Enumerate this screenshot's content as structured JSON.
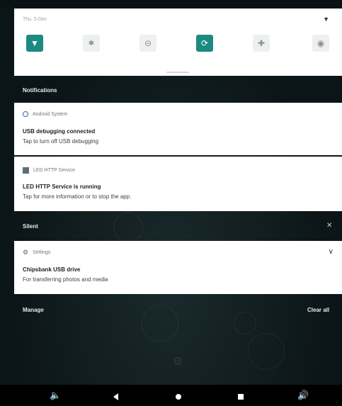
{
  "quick_settings": {
    "date": "Thu, 5 Dec",
    "tiles": [
      {
        "name": "wifi",
        "icon": "wifi-icon",
        "state": "on"
      },
      {
        "name": "bluetooth",
        "icon": "bluetooth-icon",
        "state": "off"
      },
      {
        "name": "do-not-disturb",
        "icon": "dnd-icon",
        "state": "off"
      },
      {
        "name": "auto-rotate",
        "icon": "rotate-icon",
        "state": "on"
      },
      {
        "name": "airplane-mode",
        "icon": "airplane-icon",
        "state": "off"
      },
      {
        "name": "location",
        "icon": "location-icon",
        "state": "off"
      }
    ],
    "accent_color": "#1d8a82"
  },
  "sections": {
    "notifications_label": "Notifications",
    "silent_label": "Silent",
    "manage_label": "Manage",
    "clear_all_label": "Clear all"
  },
  "notifications": [
    {
      "app": "Android System",
      "title": "USB debugging connected",
      "text": "Tap to turn off USB debugging"
    },
    {
      "app": "LED HTTP Service",
      "title": "LED HTTP Service is running",
      "text": "Tap for more information or to stop the app."
    }
  ],
  "silent_notifications": [
    {
      "app": "Settings",
      "title": "Chipsbank USB drive",
      "text": "For transferring photos and media"
    }
  ],
  "navbar": {
    "buttons": [
      "volume-down-icon",
      "back-icon",
      "home-icon",
      "recents-icon",
      "volume-up-icon"
    ]
  }
}
